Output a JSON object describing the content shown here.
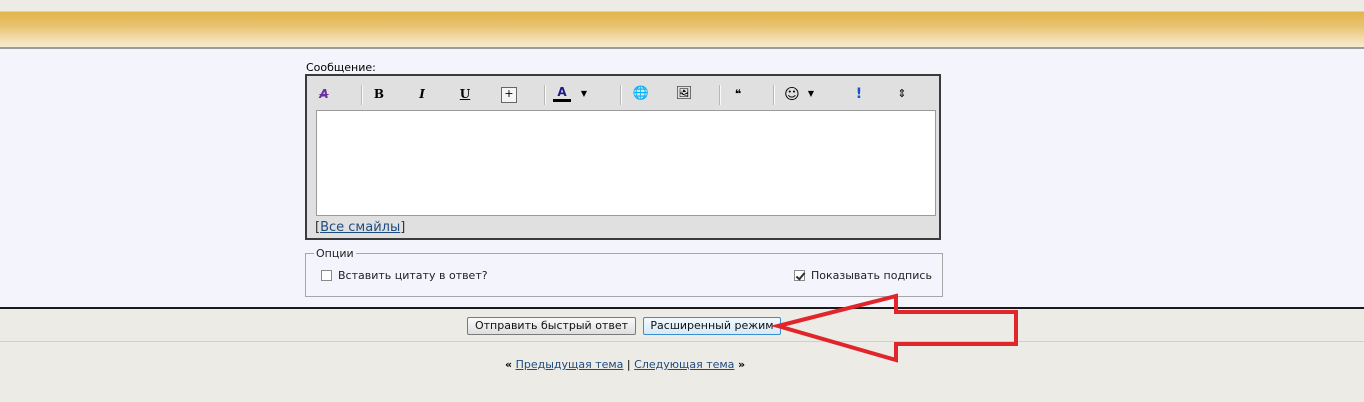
{
  "editor": {
    "message_label": "Сообщение:",
    "toolbar": [
      {
        "name": "remove-format-icon",
        "glyph": "A"
      },
      {
        "name": "bold-button",
        "glyph": "B"
      },
      {
        "name": "italic-button",
        "glyph": "I"
      },
      {
        "name": "underline-button",
        "glyph": "U"
      },
      {
        "name": "spoiler-button",
        "glyph": "+"
      },
      {
        "name": "font-color-button",
        "glyph": "A"
      },
      {
        "name": "insert-link-icon",
        "glyph": "🌐"
      },
      {
        "name": "insert-image-icon",
        "glyph": "🖼"
      },
      {
        "name": "quote-icon",
        "glyph": "❝"
      },
      {
        "name": "smiley-icon",
        "glyph": "☺"
      },
      {
        "name": "exclamation-icon",
        "glyph": "!"
      },
      {
        "name": "resize-icon",
        "glyph": "⇕"
      }
    ],
    "all_smiles_link": "Все смайлы",
    "bracket_open": "[",
    "bracket_close": "]"
  },
  "options": {
    "legend": "Опции",
    "quote_label": "Вставить цитату в ответ?",
    "quote_checked": false,
    "signature_label": "Показывать подпись",
    "signature_checked": true
  },
  "buttons": {
    "quick_reply": "Отправить быстрый ответ",
    "advanced_mode": "Расширенный режим"
  },
  "nav": {
    "prev_arrow": "«",
    "prev": "Предыдущая тема",
    "separator": "|",
    "next": "Следующая тема",
    "next_arrow": "»"
  },
  "annotation": {
    "arrow_color": "#e0262b"
  }
}
